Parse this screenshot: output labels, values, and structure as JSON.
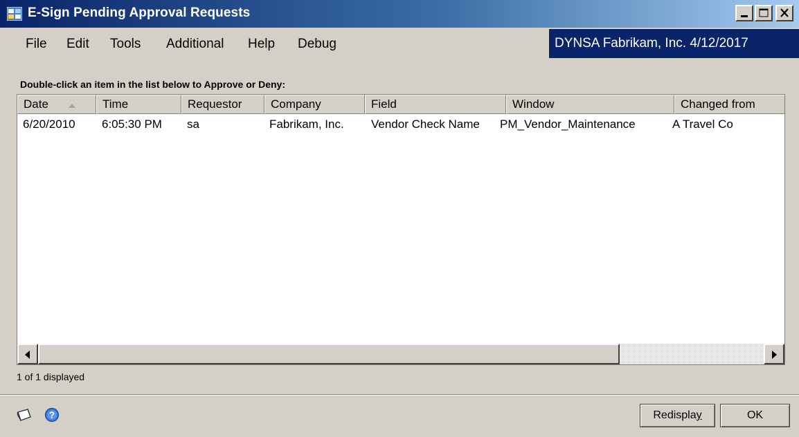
{
  "window": {
    "title": "E-Sign Pending Approval Requests",
    "icons": {
      "app": "grid-app-icon",
      "minimize": "minimize-icon",
      "maximize": "maximize-icon",
      "close": "close-icon"
    }
  },
  "menu": {
    "items": [
      "File",
      "Edit",
      "Tools",
      "Additional",
      "Help",
      "Debug"
    ]
  },
  "company_info": "DYNSA Fabrikam, Inc. 4/12/2017",
  "instruction": "Double-click an item in the list below to Approve or Deny:",
  "list": {
    "columns": [
      "Date",
      "Time",
      "Requestor",
      "Company",
      "Field",
      "Window",
      "Changed from"
    ],
    "sort_column": "Date",
    "rows": [
      [
        "6/20/2010",
        "6:05:30 PM",
        "sa",
        "Fabrikam, Inc.",
        "Vendor Check Name",
        "PM_Vendor_Maintenance",
        "A Travel Co"
      ]
    ]
  },
  "status_text": "1 of 1 displayed",
  "buttons": {
    "redisplay_prefix": "Redispla",
    "redisplay_underlined": "y",
    "ok": "OK"
  },
  "footer_icons": [
    "note-icon",
    "help-icon"
  ],
  "colors": {
    "title_gradient_start": "#0a246a",
    "title_gradient_end": "#a6caf0",
    "company_box": "#0a246a",
    "face": "#d4d0c8"
  }
}
